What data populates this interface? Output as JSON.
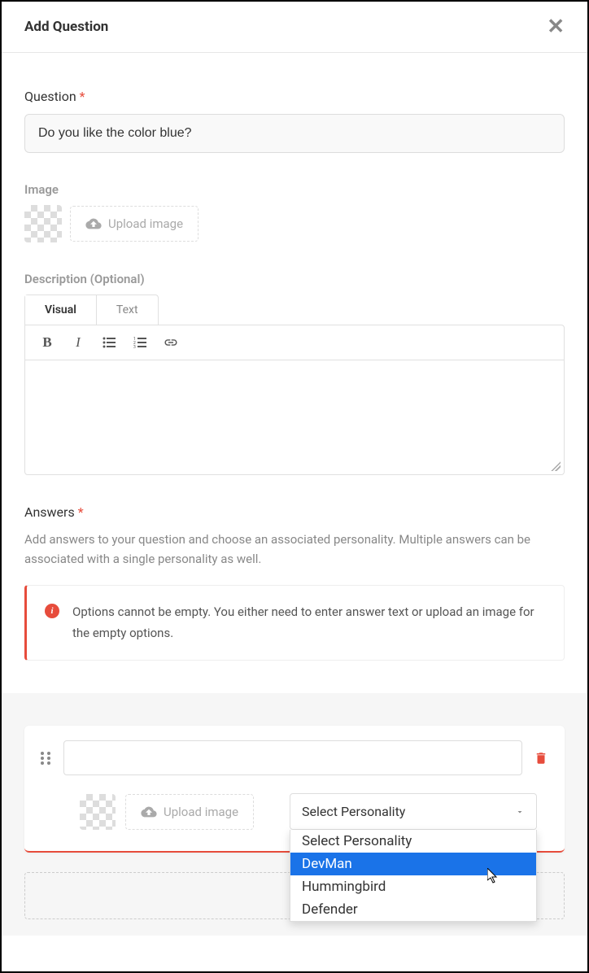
{
  "modal": {
    "title": "Add Question"
  },
  "question": {
    "label": "Question",
    "value": "Do you like the color blue?"
  },
  "image": {
    "label": "Image",
    "upload_label": "Upload image"
  },
  "description": {
    "label": "Description (Optional)",
    "tabs": {
      "visual": "Visual",
      "text": "Text"
    }
  },
  "answers": {
    "label": "Answers",
    "help": "Add answers to your question and choose an associated personality. Multiple answers can be associated with a single personality as well.",
    "error": "Options cannot be empty. You either need to enter answer text or upload an image for the empty options.",
    "upload_label": "Upload image",
    "select": {
      "placeholder": "Select Personality",
      "options": [
        "Select Personality",
        "DevMan",
        "Hummingbird",
        "Defender"
      ],
      "highlighted": "DevMan"
    }
  }
}
